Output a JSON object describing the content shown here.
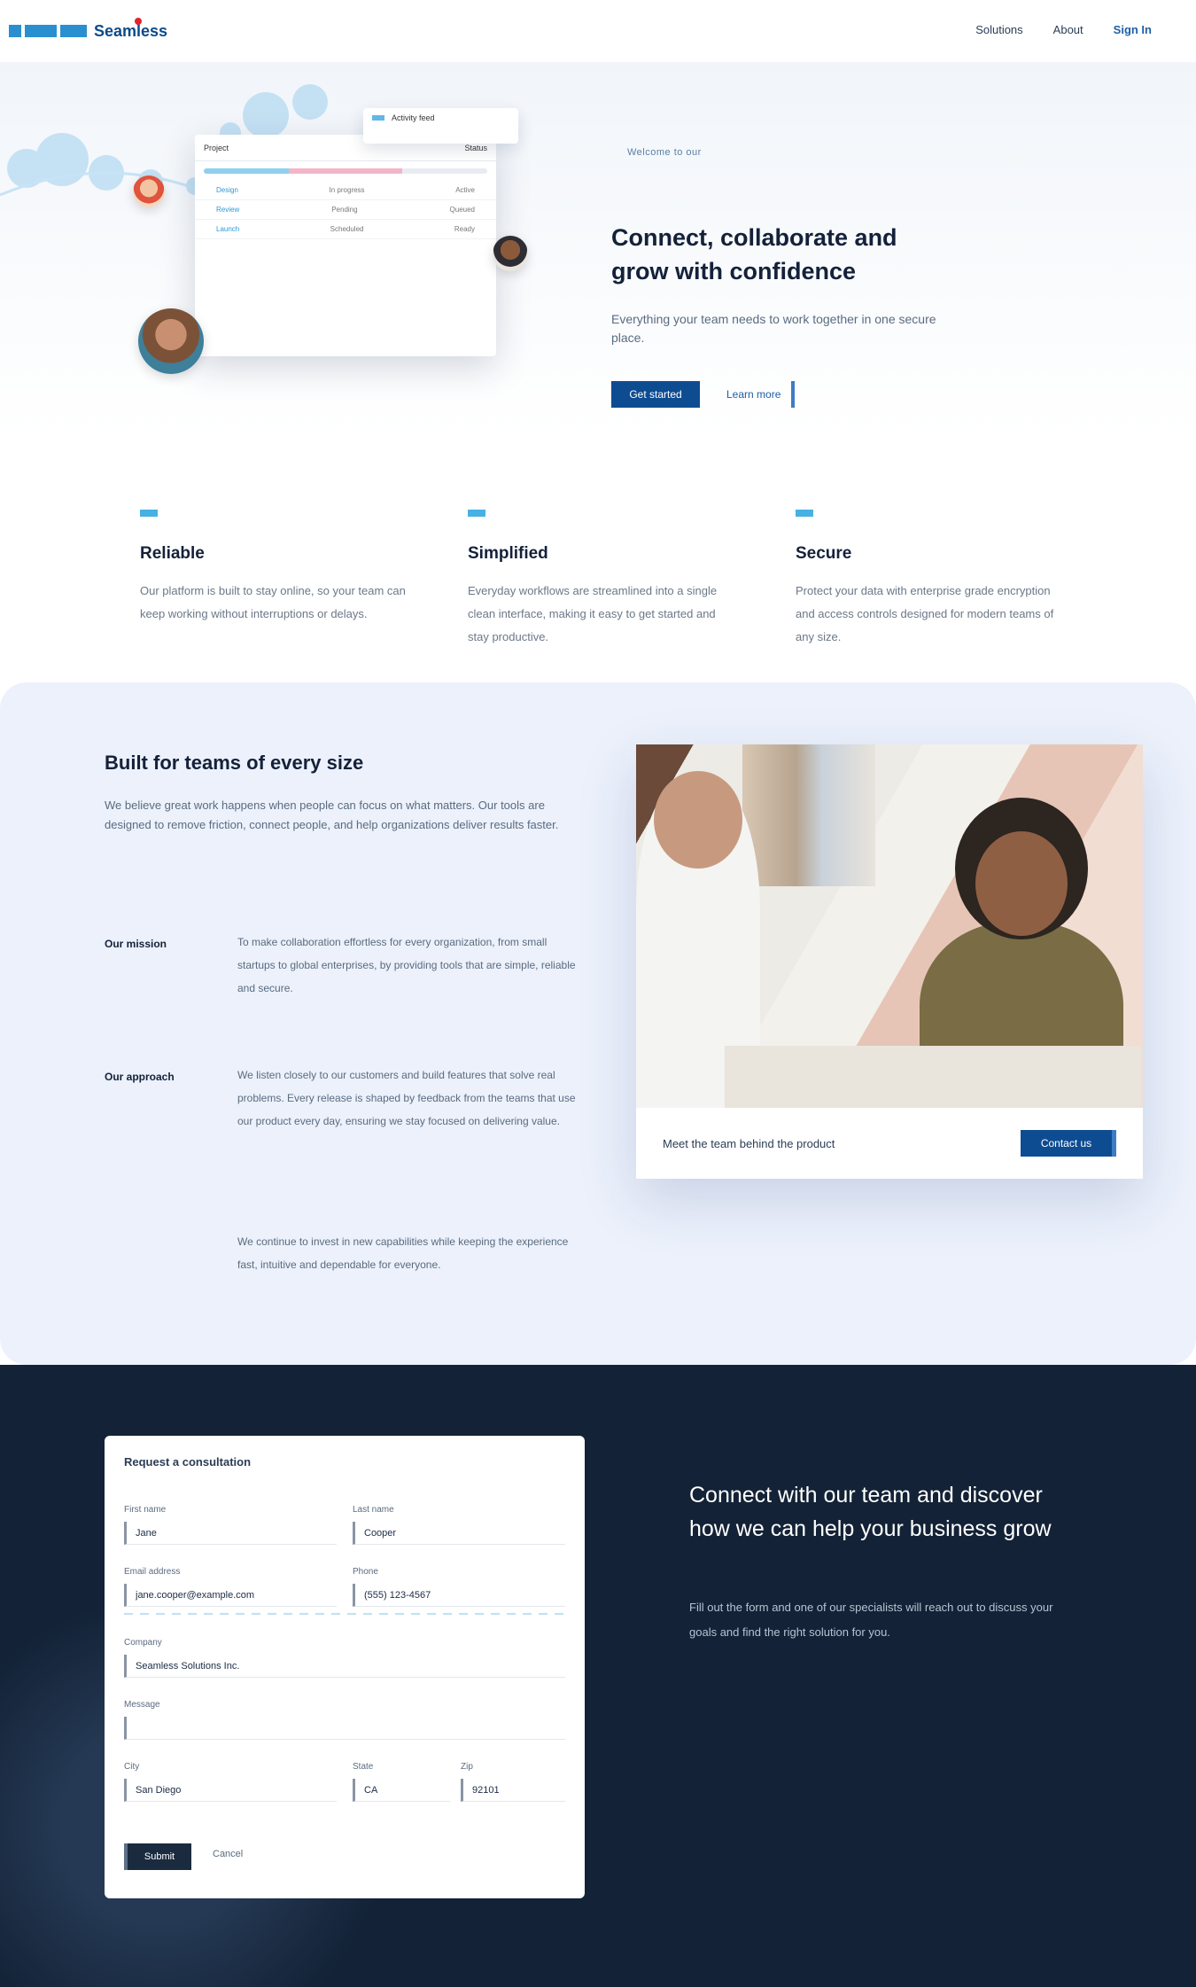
{
  "header": {
    "logo_text": "Seamless",
    "nav": [
      "Solutions",
      "About",
      "Sign In"
    ]
  },
  "hero": {
    "eyebrow": "Welcome to our",
    "title": "Connect, collaborate and grow with confidence",
    "description": "Everything your team needs to work together in one secure place.",
    "primary_cta": "Get started",
    "secondary_cta": "Learn more",
    "mock": {
      "float_label": "Activity feed",
      "header_left": "Project",
      "header_right": "Status",
      "rows": [
        [
          "Design",
          "In progress",
          "Active"
        ],
        [
          "Review",
          "Pending",
          "Queued"
        ],
        [
          "Launch",
          "Scheduled",
          "Ready"
        ]
      ]
    }
  },
  "features": [
    {
      "title": "Reliable",
      "text": "Our platform is built to stay online, so your team can keep working without interruptions or delays."
    },
    {
      "title": "Simplified",
      "text": "Everyday workflows are streamlined into a single clean interface, making it easy to get started and stay productive."
    },
    {
      "title": "Secure",
      "text": "Protect your data with enterprise grade encryption and access controls designed for modern teams of any size."
    }
  ],
  "about": {
    "title": "Built for teams of every size",
    "lead": "We believe great work happens when people can focus on what matters. Our tools are designed to remove friction, connect people, and help organizations deliver results faster.",
    "items": [
      {
        "term": "Our mission",
        "desc": "To make collaboration effortless for every organization, from small startups to global enterprises, by providing tools that are simple, reliable and secure."
      },
      {
        "term": "Our approach",
        "desc": "We listen closely to our customers and build features that solve real problems. Every release is shaped by feedback from the teams that use our product every day, ensuring we stay focused on delivering value."
      },
      {
        "term": "",
        "desc": "We continue to invest in new capabilities while keeping the experience fast, intuitive and dependable for everyone."
      }
    ],
    "card_caption": "Meet the team behind the product",
    "card_button": "Contact us"
  },
  "contact": {
    "form_title": "Request a consultation",
    "fields": {
      "first_name": {
        "label": "First name",
        "value": "Jane"
      },
      "last_name": {
        "label": "Last name",
        "value": "Cooper"
      },
      "email": {
        "label": "Email address",
        "value": "jane.cooper@example.com"
      },
      "phone": {
        "label": "Phone",
        "value": "(555) 123-4567"
      },
      "company": {
        "label": "Company",
        "value": "Seamless Solutions Inc."
      },
      "message": {
        "label": "Message",
        "value": ""
      },
      "city": {
        "label": "City",
        "value": "San Diego"
      },
      "state": {
        "label": "State",
        "value": "CA"
      },
      "zip": {
        "label": "Zip",
        "value": "92101"
      }
    },
    "submit": "Submit",
    "reset": "Cancel",
    "title": "Connect with our team and discover how we can help your business grow",
    "text": "Fill out the form and one of our specialists will reach out to discuss your goals and find the right solution for you."
  },
  "colors": {
    "brand": "#0e4c92",
    "accent": "#47b1e3",
    "dark": "#132236",
    "light": "#ecf1fb"
  }
}
